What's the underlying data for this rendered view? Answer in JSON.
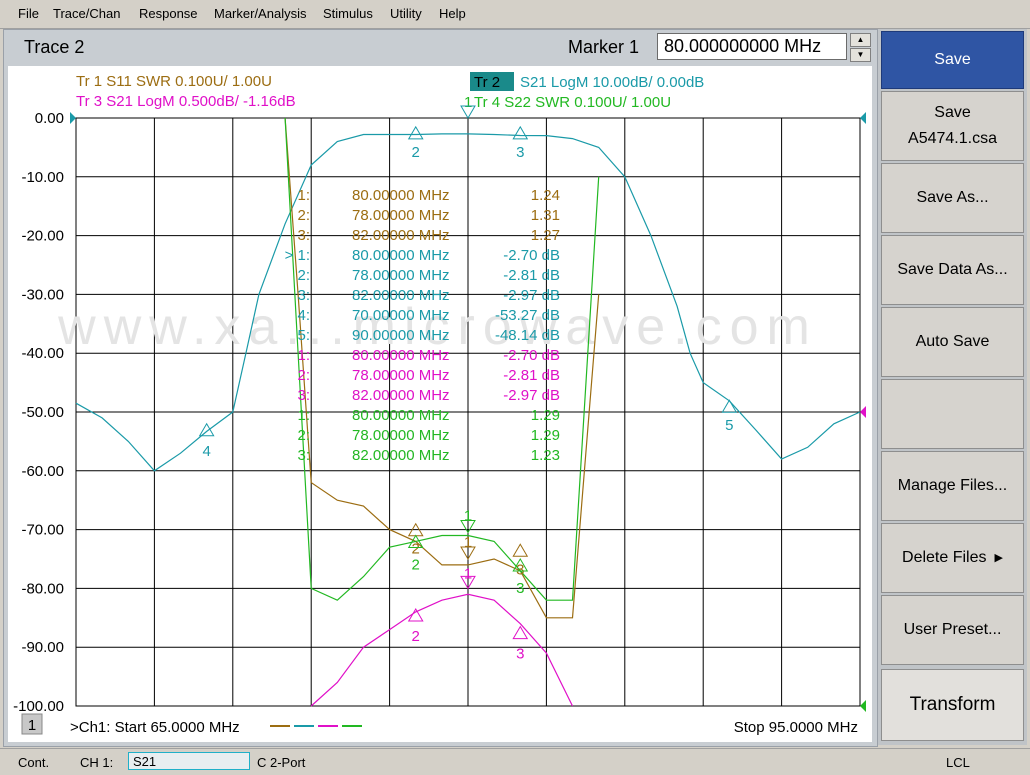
{
  "menu": [
    "File",
    "Trace/Chan",
    "Response",
    "Marker/Analysis",
    "Stimulus",
    "Utility",
    "Help"
  ],
  "title": "Trace 2",
  "marker": {
    "label": "Marker 1",
    "value": "80.000000000 MHz"
  },
  "traces": [
    {
      "text": "Tr  1   S11 SWR 0.100U/  1.00U",
      "color": "#9c6d12"
    },
    {
      "text": "Tr  3   S21 LogM 0.500dB/  -1.16dB",
      "color": "#e010c8"
    },
    {
      "badge": "Tr  2",
      "text": "S21 LogM 10.00dB/  0.00dB",
      "color": "#1a9aa8"
    },
    {
      "prefix": "1",
      "text": "Tr  4   S22 SWR 0.100U/  1.00U",
      "color": "#22b822"
    }
  ],
  "y_ticks": [
    "0.00",
    "-10.00",
    "-20.00",
    "-30.00",
    "-40.00",
    "-50.00",
    "-60.00",
    "-70.00",
    "-80.00",
    "-90.00",
    "-100.00"
  ],
  "marker_table": [
    {
      "idx": "1:",
      "freq": "80.00000 MHz",
      "val": "1.24",
      "color": "#9c6d12"
    },
    {
      "idx": "2:",
      "freq": "78.00000 MHz",
      "val": "1.31",
      "color": "#9c6d12"
    },
    {
      "idx": "3:",
      "freq": "82.00000 MHz",
      "val": "1.27",
      "color": "#9c6d12"
    },
    {
      "idx": "> 1:",
      "freq": "80.00000 MHz",
      "val": "-2.70 dB",
      "color": "#1a9aa8"
    },
    {
      "idx": "2:",
      "freq": "78.00000 MHz",
      "val": "-2.81 dB",
      "color": "#1a9aa8"
    },
    {
      "idx": "3:",
      "freq": "82.00000 MHz",
      "val": "-2.97 dB",
      "color": "#1a9aa8"
    },
    {
      "idx": "4:",
      "freq": "70.00000 MHz",
      "val": "-53.27 dB",
      "color": "#1a9aa8"
    },
    {
      "idx": "5:",
      "freq": "90.00000 MHz",
      "val": "-48.14 dB",
      "color": "#1a9aa8"
    },
    {
      "idx": "1:",
      "freq": "80.00000 MHz",
      "val": "-2.70 dB",
      "color": "#e010c8"
    },
    {
      "idx": "2:",
      "freq": "78.00000 MHz",
      "val": "-2.81 dB",
      "color": "#e010c8"
    },
    {
      "idx": "3:",
      "freq": "82.00000 MHz",
      "val": "-2.97 dB",
      "color": "#e010c8"
    },
    {
      "idx": "1:",
      "freq": "80.00000 MHz",
      "val": "1.29",
      "color": "#22b822"
    },
    {
      "idx": "2:",
      "freq": "78.00000 MHz",
      "val": "1.29",
      "color": "#22b822"
    },
    {
      "idx": "3:",
      "freq": "82.00000 MHz",
      "val": "1.23",
      "color": "#22b822"
    }
  ],
  "watermark": "www.xa...microwave.com",
  "bottom": {
    "channel_num": "1",
    "start": ">Ch1: Start  65.0000 MHz",
    "stop": "Stop  95.0000 MHz"
  },
  "softkeys": [
    "Save",
    "Save|A5474.1.csa",
    "Save As...",
    "Save Data As...",
    "Auto Save",
    "",
    "Manage Files...",
    "Delete Files",
    "User Preset...",
    "Transform"
  ],
  "status": {
    "mode": "Cont.",
    "ch": "CH 1:",
    "param": "S21",
    "cal": "C  2-Port",
    "lcl": "LCL"
  },
  "chart_data": {
    "type": "line",
    "xlabel": "",
    "ylabel": "",
    "xlim": [
      65,
      95
    ],
    "ylim": [
      -100,
      0
    ],
    "series": [
      {
        "name": "Tr 2 S21 LogM",
        "color": "#1a9aa8",
        "x": [
          65,
          66,
          67,
          68,
          69,
          70,
          71,
          71.5,
          72,
          73,
          74,
          75,
          76,
          77,
          78,
          79,
          80,
          81,
          82,
          83,
          84,
          85,
          86,
          87,
          88,
          88.5,
          89,
          90,
          91,
          92,
          93,
          94,
          95
        ],
        "y": [
          -48.5,
          -51,
          -55,
          -60,
          -57,
          -53.3,
          -50,
          -40,
          -30,
          -18,
          -8,
          -4,
          -2.8,
          -2.8,
          -2.8,
          -2.7,
          -2.7,
          -2.8,
          -2.97,
          -3,
          -3.5,
          -5,
          -10,
          -20,
          -32,
          -40,
          -45,
          -48.1,
          -53,
          -58,
          -56,
          -52,
          -50
        ]
      },
      {
        "name": "Tr 1 S11 SWR",
        "color": "#9c6d12",
        "x": [
          73,
          73.5,
          74,
          75,
          76,
          77,
          78,
          79,
          80,
          81,
          82,
          83,
          84,
          85
        ],
        "y": [
          0,
          -30,
          -62,
          -65,
          -66,
          -70,
          -72,
          -76,
          -76,
          -75,
          -77,
          -85,
          -85,
          -30
        ]
      },
      {
        "name": "Tr 3 S21 LogM",
        "color": "#e010c8",
        "x": [
          74,
          75,
          76,
          77,
          78,
          79,
          80,
          81,
          82,
          83,
          84
        ],
        "y": [
          -100,
          -96,
          -90,
          -87,
          -84,
          -82,
          -81,
          -82,
          -86,
          -91,
          -100
        ]
      },
      {
        "name": "Tr 4 S22 SWR",
        "color": "#22b822",
        "x": [
          73,
          73.5,
          74,
          75,
          76,
          77,
          78,
          79,
          80,
          81,
          82,
          83,
          84,
          85
        ],
        "y": [
          0,
          -40,
          -80,
          -82,
          -78,
          -73,
          -72,
          -71,
          -71,
          -72,
          -77,
          -82,
          -82,
          -10
        ]
      }
    ]
  }
}
